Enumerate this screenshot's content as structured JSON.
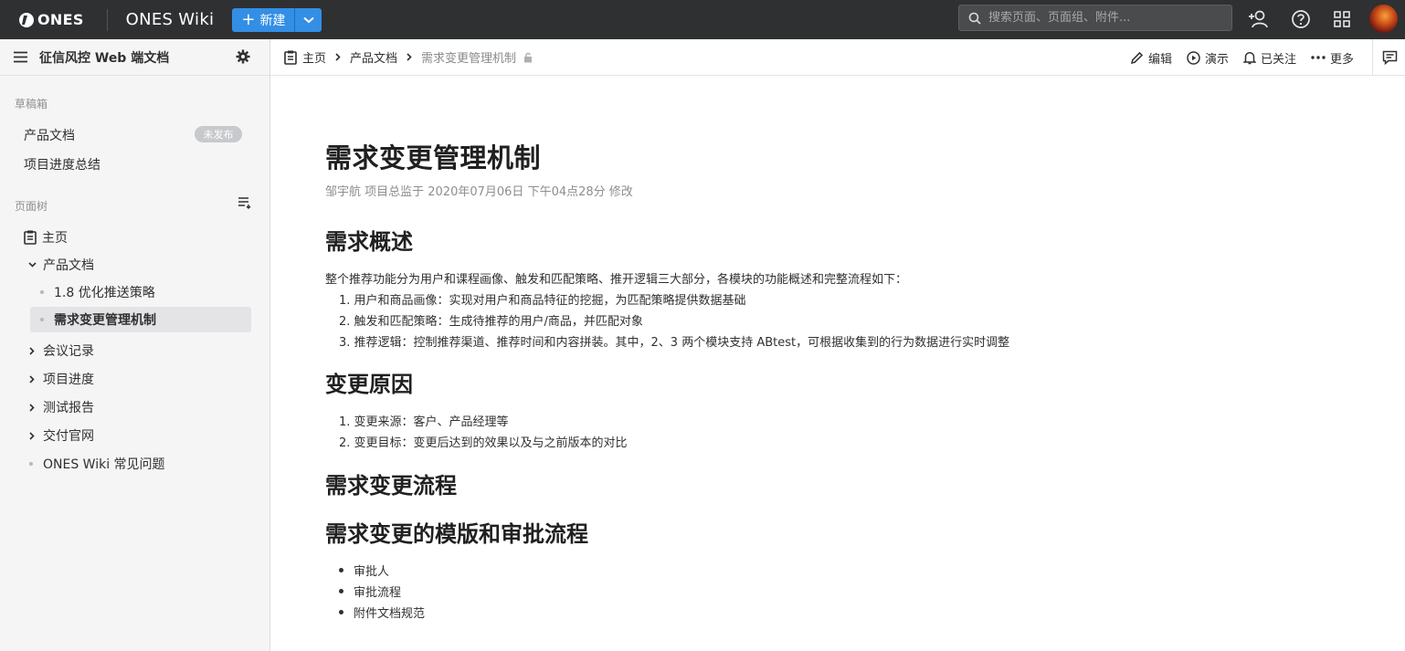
{
  "topbar": {
    "logo_text": "ONES",
    "app_title": "ONES Wiki",
    "new_button": "新建",
    "search_placeholder": "搜索页面、页面组、附件..."
  },
  "sidebar": {
    "space_title": "征信风控 Web 端文档",
    "drafts_label": "草稿箱",
    "drafts": [
      {
        "label": "产品文档",
        "badge": "未发布"
      },
      {
        "label": "项目进度总结"
      }
    ],
    "tree_label": "页面树",
    "tree": {
      "home": "主页",
      "product_docs": "产品文档",
      "child1": "1.8 优化推送策略",
      "child2": "需求变更管理机制",
      "meeting": "会议记录",
      "progress": "项目进度",
      "test": "测试报告",
      "delivery": "交付官网",
      "faq": "ONES Wiki 常见问题"
    }
  },
  "breadcrumb": {
    "home": "主页",
    "parent": "产品文档",
    "current": "需求变更管理机制"
  },
  "actions": {
    "edit": "编辑",
    "present": "演示",
    "follow": "已关注",
    "more": "更多"
  },
  "doc": {
    "title": "需求变更管理机制",
    "meta": "邹宇航 项目总监于 2020年07月06日 下午04点28分 修改",
    "s1_title": "需求概述",
    "s1_intro": "整个推荐功能分为用户和课程画像、触发和匹配策略、推开逻辑三大部分，各模块的功能概述和完整流程如下：",
    "s1_items": [
      "1. 用户和商品画像：实现对用户和商品特征的挖掘，为匹配策略提供数据基础",
      "2. 触发和匹配策略：生成待推荐的用户/商品，并匹配对象",
      "3. 推荐逻辑：控制推荐渠道、推荐时间和内容拼装。其中，2、3 两个模块支持 ABtest，可根据收集到的行为数据进行实时调整"
    ],
    "s2_title": "变更原因",
    "s2_items": [
      "1. 变更来源：客户、产品经理等",
      "2. 变更目标：变更后达到的效果以及与之前版本的对比"
    ],
    "s3_title": "需求变更流程",
    "s4_title": "需求变更的模版和审批流程",
    "s4_items": [
      "审批人",
      "审批流程",
      "附件文档规范"
    ]
  }
}
